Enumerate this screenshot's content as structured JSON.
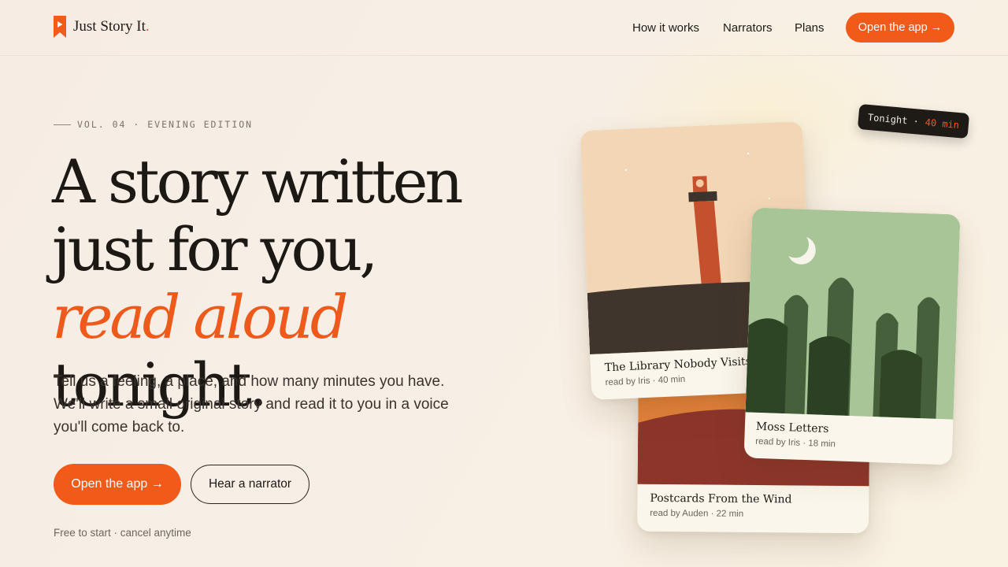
{
  "brand": {
    "name": "Just Story It",
    "dot": ".",
    "accent_color": "#f25a1a"
  },
  "nav": {
    "items": [
      {
        "label": "How it works"
      },
      {
        "label": "Narrators"
      },
      {
        "label": "Plans"
      }
    ],
    "cta_label": "Open the app →"
  },
  "hero": {
    "eyebrow": "VOL. 04 · EVENING EDITION",
    "headline_part1": "A story written just for you, ",
    "headline_accent": "read aloud",
    "headline_part2": " tonight.",
    "lede": "Tell us a feeling, a place, and how many minutes you have. We'll write a small original story and read it to you in a voice you'll come back to.",
    "primary_cta": "Open the app →",
    "secondary_cta": "Hear a narrator",
    "fineprint": "Free to start · cancel anytime"
  },
  "tonight_pill": {
    "label": "Tonight ·",
    "time": "40 min"
  },
  "cards": [
    {
      "title": "The Library Nobody Visits",
      "meta": "read by Iris · 40 min",
      "art_icon": "lighthouse-illustration"
    },
    {
      "title": "Moss Letters",
      "meta": "read by Iris · 18 min",
      "art_icon": "moon-forest-illustration"
    },
    {
      "title": "Postcards From the Wind",
      "meta": "read by Auden · 22 min",
      "art_icon": "sunset-hills-illustration"
    }
  ]
}
